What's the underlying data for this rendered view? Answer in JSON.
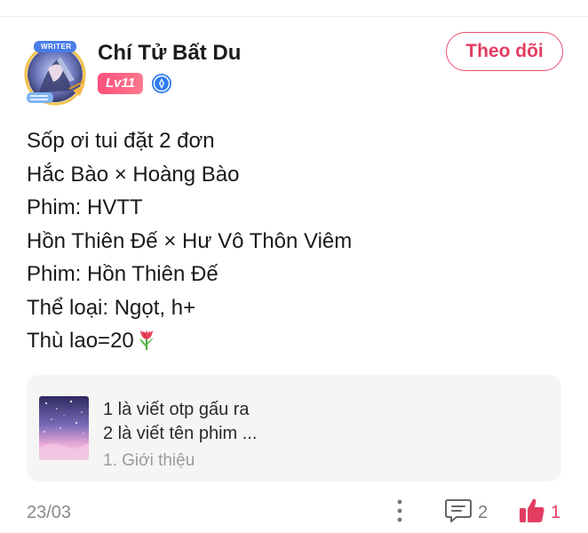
{
  "author": {
    "name": "Chí Tử Bất Du",
    "level": "Lv11",
    "avatar_frame_text": "WRITER",
    "follow_label": "Theo dõi"
  },
  "post": {
    "lines": [
      "Sốp ơi tui đặt 2 đơn",
      "Hắc Bào × Hoàng Bào",
      "Phim: HVTT",
      "Hồn Thiên Đế × Hư Vô Thôn Viêm",
      "Phim: Hồn Thiên Đế",
      "Thể loại: Ngọt, h+",
      "Thù lao=20"
    ]
  },
  "quote": {
    "line1": "1 là viết otp gấu ra",
    "line2": "2 là viết tên phim ...",
    "meta": "1. Giới thiệu"
  },
  "footer": {
    "date": "23/03",
    "comment_count": "2",
    "like_count": "1"
  },
  "colors": {
    "accent": "#e23d61",
    "badge": "#ff5a80",
    "verified": "#2f7bf2"
  }
}
